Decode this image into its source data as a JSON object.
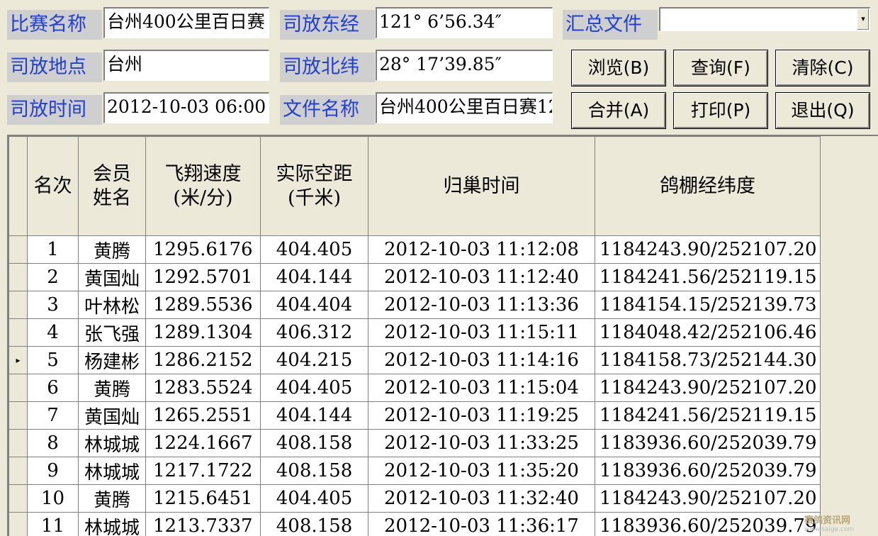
{
  "form": {
    "race_name_label": "比赛名称",
    "race_name_value": "台州400公里百日赛",
    "release_place_label": "司放地点",
    "release_place_value": "台州",
    "release_time_label": "司放时间",
    "release_time_value": "2012-10-03 06:00",
    "longitude_label": "司放东经",
    "longitude_value": "121° 6’56.34″",
    "latitude_label": "司放北纬",
    "latitude_value": "28° 17’39.85″",
    "filename_label": "文件名称",
    "filename_value": "台州400公里百日赛12",
    "summary_label": "汇总文件",
    "summary_value": ""
  },
  "buttons": {
    "browse": "浏览(B)",
    "query": "查询(F)",
    "clear": "清除(C)",
    "merge": "合并(A)",
    "print": "打印(P)",
    "exit": "退出(Q)"
  },
  "table": {
    "headers": [
      "名次",
      "会员\n姓名",
      "飞翔速度\n(米/分)",
      "实际空距\n(千米)",
      "归巢时间",
      "鸽棚经纬度"
    ],
    "current_row_marker": "▸",
    "rows": [
      [
        "1",
        "黄腾",
        "1295.6176",
        "404.405",
        "2012-10-03  11:12:08",
        "1184243.90/252107.20"
      ],
      [
        "2",
        "黄国灿",
        "1292.5701",
        "404.144",
        "2012-10-03  11:12:40",
        "1184241.56/252119.15"
      ],
      [
        "3",
        "叶林松",
        "1289.5536",
        "404.404",
        "2012-10-03  11:13:36",
        "1184154.15/252139.73"
      ],
      [
        "4",
        "张飞强",
        "1289.1304",
        "406.312",
        "2012-10-03  11:15:11",
        "1184048.42/252106.46"
      ],
      [
        "5",
        "杨建彬",
        "1286.2152",
        "404.215",
        "2012-10-03  11:14:16",
        "1184158.73/252144.30"
      ],
      [
        "6",
        "黄腾",
        "1283.5524",
        "404.405",
        "2012-10-03  11:15:04",
        "1184243.90/252107.20"
      ],
      [
        "7",
        "黄国灿",
        "1265.2551",
        "404.144",
        "2012-10-03  11:19:25",
        "1184241.56/252119.15"
      ],
      [
        "8",
        "林城城",
        "1224.1667",
        "408.158",
        "2012-10-03  11:33:25",
        "1183936.60/252039.79"
      ],
      [
        "9",
        "林城城",
        "1217.1722",
        "408.158",
        "2012-10-03  11:35:20",
        "1183936.60/252039.79"
      ],
      [
        "10",
        "黄腾",
        "1215.6451",
        "404.405",
        "2012-10-03  11:32:40",
        "1184243.90/252107.20"
      ],
      [
        "11",
        "林城城",
        "1213.7337",
        "408.158",
        "2012-10-03  11:36:17",
        "1183936.60/252039.79"
      ]
    ],
    "selected_row": 5
  },
  "watermark": {
    "name": "赛鸽资讯网",
    "url": "www.saige.com"
  }
}
